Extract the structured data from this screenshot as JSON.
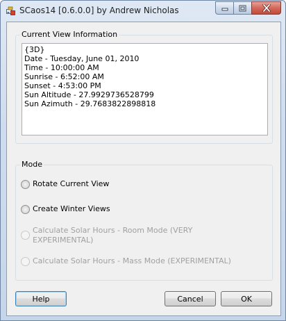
{
  "window": {
    "title": "SCaos14 [0.6.0.0] by Andrew Nicholas"
  },
  "current_view": {
    "legend": "Current View Information",
    "lines": [
      "{3D}",
      "Date - Tuesday, June 01, 2010",
      "Time - 10:00:00 AM",
      "Sunrise - 6:52:00 AM",
      "Sunset - 4:53:00 PM",
      "Sun Altitude - 27.9929736528799",
      "Sun Azimuth - 29.7683822898818"
    ]
  },
  "mode": {
    "legend": "Mode",
    "options": [
      {
        "label": "Rotate Current View",
        "enabled": true
      },
      {
        "label": "Create Winter Views",
        "enabled": true
      },
      {
        "label": "Calculate Solar Hours - Room Mode (VERY\nEXPERIMENTAL)",
        "enabled": false
      },
      {
        "label": "Calculate Solar Hours - Mass Mode (EXPERIMENTAL)",
        "enabled": false
      }
    ]
  },
  "buttons": {
    "help": "Help",
    "cancel": "Cancel",
    "ok": "OK"
  },
  "icons": {
    "app": "app-icon",
    "minimize": "minimize-icon",
    "maximize": "maximize-icon",
    "close": "close-icon"
  }
}
